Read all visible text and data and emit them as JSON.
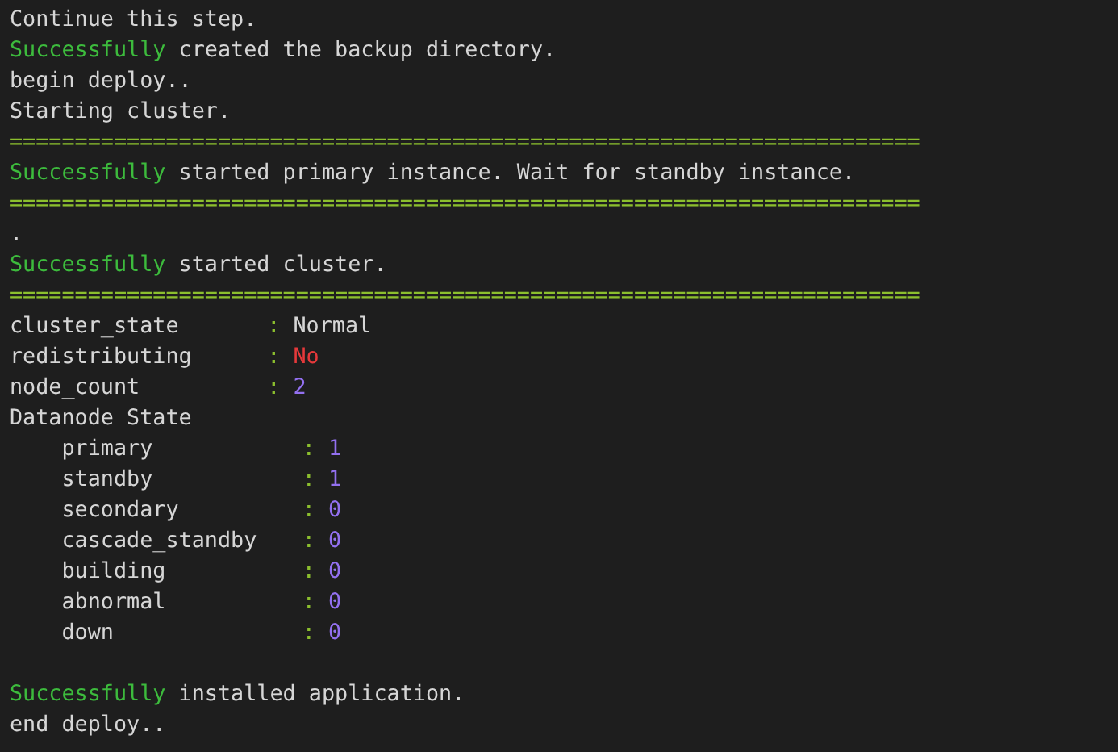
{
  "terminal": {
    "lines": [
      {
        "kind": "text",
        "text": "Continue this step."
      },
      {
        "kind": "success",
        "status": "Successfully",
        "text": "created the backup directory."
      },
      {
        "kind": "text",
        "text": "begin deploy.."
      },
      {
        "kind": "text",
        "text": "Starting cluster."
      },
      {
        "kind": "separator",
        "text": "======================================================================"
      },
      {
        "kind": "success",
        "status": "Successfully",
        "text": "started primary instance. Wait for standby instance."
      },
      {
        "kind": "separator",
        "text": "======================================================================"
      },
      {
        "kind": "text",
        "text": "."
      },
      {
        "kind": "success",
        "status": "Successfully",
        "text": "started cluster."
      },
      {
        "kind": "separator",
        "text": "======================================================================"
      },
      {
        "kind": "kv",
        "indented": false,
        "key": "cluster_state",
        "sep": ":",
        "value": "Normal",
        "color": "#d6d6d6"
      },
      {
        "kind": "kv",
        "indented": false,
        "key": "redistributing",
        "sep": ":",
        "value": "No",
        "color": "#e5393b"
      },
      {
        "kind": "kv",
        "indented": false,
        "key": "node_count",
        "sep": ":",
        "value": "2",
        "color": "#9370f0"
      },
      {
        "kind": "text",
        "text": "Datanode State"
      },
      {
        "kind": "kv",
        "indented": true,
        "key": "primary",
        "sep": ":",
        "value": "1",
        "color": "#9370f0"
      },
      {
        "kind": "kv",
        "indented": true,
        "key": "standby",
        "sep": ":",
        "value": "1",
        "color": "#9370f0"
      },
      {
        "kind": "kv",
        "indented": true,
        "key": "secondary",
        "sep": ":",
        "value": "0",
        "color": "#9370f0"
      },
      {
        "kind": "kv",
        "indented": true,
        "key": "cascade_standby",
        "sep": ":",
        "value": "0",
        "color": "#9370f0"
      },
      {
        "kind": "kv",
        "indented": true,
        "key": "building",
        "sep": ":",
        "value": "0",
        "color": "#9370f0"
      },
      {
        "kind": "kv",
        "indented": true,
        "key": "abnormal",
        "sep": ":",
        "value": "0",
        "color": "#9370f0"
      },
      {
        "kind": "kv",
        "indented": true,
        "key": "down",
        "sep": ":",
        "value": "0",
        "color": "#9370f0"
      },
      {
        "kind": "blank"
      },
      {
        "kind": "success",
        "status": "Successfully",
        "text": "installed application."
      },
      {
        "kind": "text",
        "text": "end deploy.."
      }
    ]
  }
}
